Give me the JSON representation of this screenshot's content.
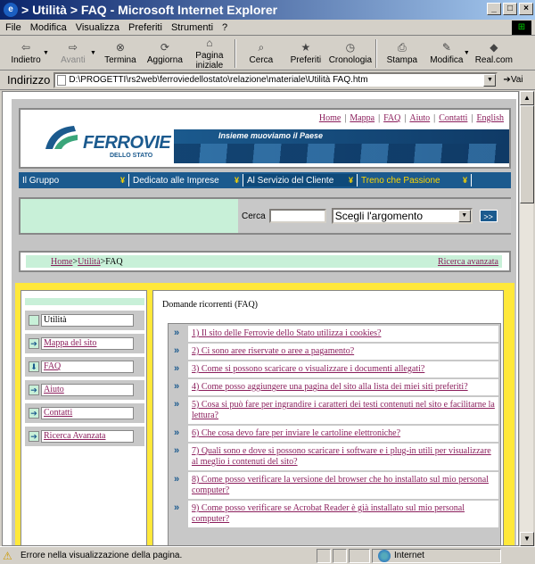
{
  "window": {
    "title": "> Utilità > FAQ - Microsoft Internet Explorer",
    "controls": [
      "_",
      "□",
      "×"
    ]
  },
  "menu": [
    "File",
    "Modifica",
    "Visualizza",
    "Preferiti",
    "Strumenti",
    "?"
  ],
  "toolbar": {
    "back": "Indietro",
    "forward": "Avanti",
    "stop": "Termina",
    "refresh": "Aggiorna",
    "home": "Pagina iniziale",
    "search": "Cerca",
    "favorites": "Preferiti",
    "history": "Cronologia",
    "print": "Stampa",
    "edit": "Modifica",
    "real": "Real.com"
  },
  "address": {
    "label": "Indirizzo",
    "value": "D:\\PROGETTI\\rs2web\\ferroviedellostato\\relazione\\materiale\\Utilità FAQ.htm",
    "go": "Vai"
  },
  "site": {
    "logo_text": "FERROVIE",
    "logo_sub": "DELLO STATO",
    "slogan": "Insieme muoviamo il Paese",
    "toplinks": [
      "Home",
      "Mappa",
      "FAQ",
      "Aiuto",
      "Contatti",
      "English"
    ],
    "nav": [
      "Il Gruppo",
      "Dedicato alle Imprese",
      "Al Servizio del Cliente",
      "Treno che Passione"
    ],
    "search_label": "Cerca",
    "search_select": "Scegli l'argomento",
    "search_go": ">>",
    "breadcrumb": {
      "home": "Home",
      "sep1": " > ",
      "utilita": "Utilità",
      "sep2": " > ",
      "current": "FAQ"
    },
    "advanced_search": "Ricerca avanzata",
    "sidebar": [
      {
        "label": "Utilità",
        "current": true
      },
      {
        "label": "Mappa del sito",
        "current": false
      },
      {
        "label": "FAQ",
        "current": false
      },
      {
        "label": "Aiuto",
        "current": false
      },
      {
        "label": "Contatti",
        "current": false
      },
      {
        "label": "Ricerca Avanzata",
        "current": false
      }
    ],
    "faq_title": "Domande ricorrenti (FAQ)",
    "faq": [
      "1) Il sito delle Ferrovie dello Stato utilizza i cookies?",
      "2) Ci sono aree riservate o aree a pagamento?",
      "3) Come si possono scaricare o visualizzare i documenti allegati?",
      "4) Come posso aggiungere una pagina del sito alla lista dei miei siti preferiti?",
      "5) Cosa si può fare per ingrandire i caratteri dei testi contenuti nel sito e facilitarne la lettura?",
      "6) Che cosa devo fare per inviare le cartoline elettroniche?",
      "7) Quali sono e dove si possono scaricare i software e i plug-in utili per visualizzare al meglio i contenuti del sito?",
      "8) Come posso verificare la versione del browser che ho installato sul mio personal computer?",
      "9) Come posso verificare se Acrobat Reader è già installato sul mio personal computer?"
    ]
  },
  "status": {
    "text": "Errore nella visualizzazione della pagina.",
    "zone": "Internet"
  }
}
